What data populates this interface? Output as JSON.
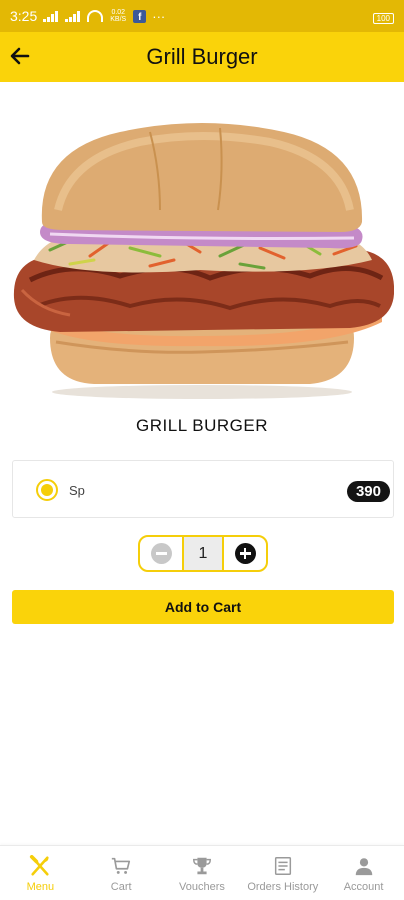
{
  "status_bar": {
    "time": "3:25",
    "speed": "0.02 KB/S",
    "more": "···",
    "battery": "100"
  },
  "header": {
    "title": "Grill Burger"
  },
  "product": {
    "name": "GRILL BURGER",
    "image_icon": "burger-photo"
  },
  "option": {
    "label": "Sp",
    "price": "390",
    "selected": true
  },
  "quantity": {
    "value": "1"
  },
  "actions": {
    "add_to_cart": "Add to Cart"
  },
  "nav": {
    "items": [
      {
        "label": "Menu",
        "icon": "fork-knife-icon",
        "active": true
      },
      {
        "label": "Cart",
        "icon": "cart-icon",
        "active": false
      },
      {
        "label": "Vouchers",
        "icon": "trophy-icon",
        "active": false
      },
      {
        "label": "Orders History",
        "icon": "receipt-icon",
        "active": false
      },
      {
        "label": "Account",
        "icon": "person-icon",
        "active": false
      }
    ]
  },
  "colors": {
    "accent": "#fad30a",
    "status_bar": "#e3b805",
    "inactive": "#9a9a9a",
    "price_pill": "#141414"
  }
}
